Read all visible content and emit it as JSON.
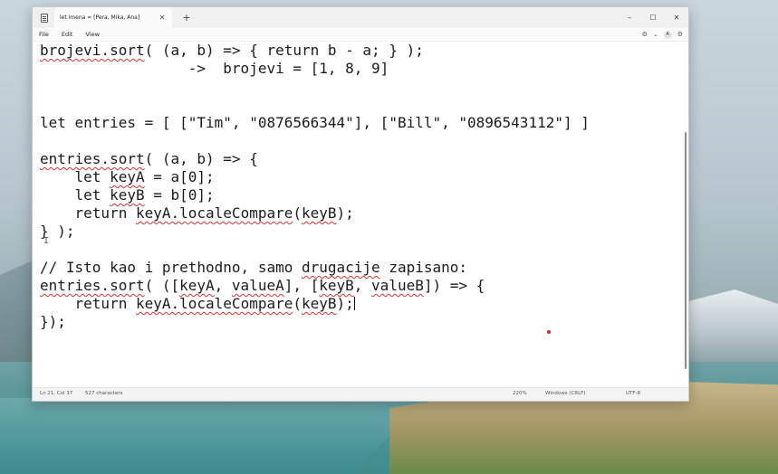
{
  "window": {
    "tab_title": "let imena = [Pera, Mika, Ana]",
    "tab_close": "✕",
    "new_tab": "+",
    "controls": {
      "minimize": "–",
      "maximize": "☐",
      "close": "✕"
    }
  },
  "menu": {
    "items": [
      "File",
      "Edit",
      "View"
    ],
    "right_icons": {
      "format": "⚙",
      "chevron": "⌄",
      "avatar": "A",
      "settings": "⚙"
    }
  },
  "editor": {
    "lines": [
      [
        {
          "t": "brojevi.sort",
          "sq": true
        },
        {
          "t": "( (a, b) => { return b - a; } );"
        }
      ],
      [
        {
          "t": "                 ->  brojevi = [1, 8, 9]"
        }
      ],
      [
        {
          "t": ""
        }
      ],
      [
        {
          "t": ""
        }
      ],
      [
        {
          "t": "let entries = [ [\"Tim\", \"0876566344\"], [\"Bill\", \"0896543112\"] ]"
        }
      ],
      [
        {
          "t": ""
        }
      ],
      [
        {
          "t": "entries.sort",
          "sq": true
        },
        {
          "t": "( (a, b) => {"
        }
      ],
      [
        {
          "t": "    let "
        },
        {
          "t": "keyA",
          "sq": true
        },
        {
          "t": " = a[0];"
        }
      ],
      [
        {
          "t": "    let "
        },
        {
          "t": "keyB",
          "sq": true
        },
        {
          "t": " = b[0];"
        }
      ],
      [
        {
          "t": "    return "
        },
        {
          "t": "keyA.localeCompare",
          "sq": true
        },
        {
          "t": "("
        },
        {
          "t": "keyB",
          "sq": true
        },
        {
          "t": ");"
        }
      ],
      [
        {
          "t": "} );"
        }
      ],
      [
        {
          "t": ""
        }
      ],
      [
        {
          "t": "// Isto kao i prethodno, samo "
        },
        {
          "t": "drugacije",
          "sq": true
        },
        {
          "t": " zapisano:"
        }
      ],
      [
        {
          "t": "entries.sort",
          "sq": true
        },
        {
          "t": "( (["
        },
        {
          "t": "keyA",
          "sq": true
        },
        {
          "t": ", "
        },
        {
          "t": "valueA",
          "sq": true
        },
        {
          "t": "], ["
        },
        {
          "t": "keyB",
          "sq": true
        },
        {
          "t": ", "
        },
        {
          "t": "valueB",
          "sq": true
        },
        {
          "t": "]) => {"
        }
      ],
      [
        {
          "t": "    return "
        },
        {
          "t": "keyA.localeCompare",
          "sq": true
        },
        {
          "t": "("
        },
        {
          "t": "keyB",
          "sq": true
        },
        {
          "t": ");",
          "caret": true
        }
      ],
      [
        {
          "t": "});"
        }
      ]
    ]
  },
  "status": {
    "position": "Ln 21, Col 37",
    "characters": "527 characters",
    "zoom": "220%",
    "line_ending": "Windows (CRLF)",
    "encoding": "UTF-8"
  }
}
